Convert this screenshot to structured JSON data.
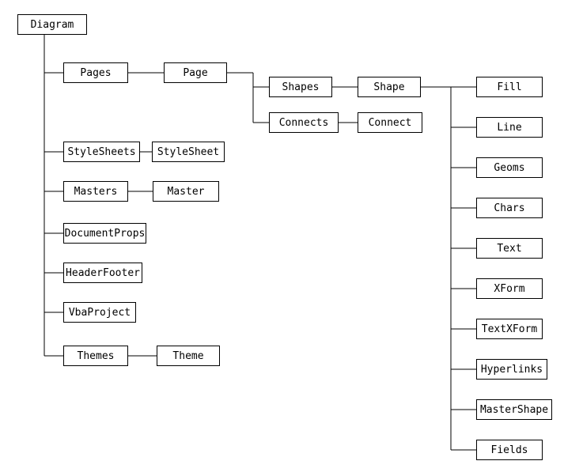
{
  "root": {
    "label": "Diagram"
  },
  "level1": {
    "pages": "Pages",
    "stylesheets": "StyleSheets",
    "masters": "Masters",
    "documentprops": "DocumentProps",
    "headerfooter": "HeaderFooter",
    "vbaproject": "VbaProject",
    "themes": "Themes"
  },
  "level2": {
    "page": "Page",
    "stylesheet": "StyleSheet",
    "master": "Master",
    "theme": "Theme"
  },
  "level3": {
    "shapes": "Shapes",
    "connects": "Connects"
  },
  "level4": {
    "shape": "Shape",
    "connect": "Connect"
  },
  "level5": {
    "fill": "Fill",
    "line": "Line",
    "geoms": "Geoms",
    "chars": "Chars",
    "text": "Text",
    "xform": "XForm",
    "textxform": "TextXForm",
    "hyperlinks": "Hyperlinks",
    "mastershape": "MasterShape",
    "fields": "Fields"
  }
}
